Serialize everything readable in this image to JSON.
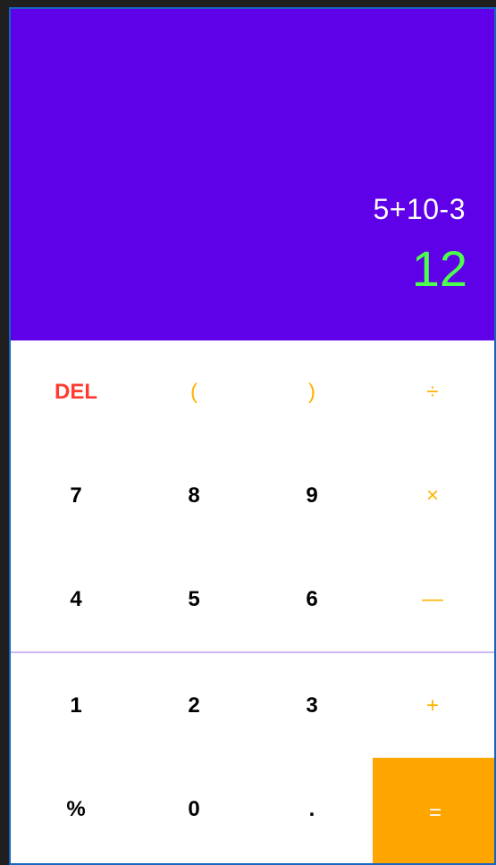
{
  "display": {
    "expression": "5+10-3",
    "result": "12"
  },
  "colors": {
    "display_bg": "#5e00e8",
    "result_text": "#4cff4c",
    "operator_text": "#ffb300",
    "delete_text": "#ff3b30",
    "equals_bg": "#ffa500"
  },
  "keypad": {
    "row1": {
      "del": "DEL",
      "open_paren": "(",
      "close_paren": ")",
      "divide": "÷"
    },
    "row2": {
      "seven": "7",
      "eight": "8",
      "nine": "9",
      "multiply": "×"
    },
    "row3": {
      "four": "4",
      "five": "5",
      "six": "6",
      "minus": "—"
    },
    "row4": {
      "one": "1",
      "two": "2",
      "three": "3",
      "plus": "+"
    },
    "row5": {
      "percent": "%",
      "zero": "0",
      "dot": ".",
      "equals": "="
    }
  }
}
